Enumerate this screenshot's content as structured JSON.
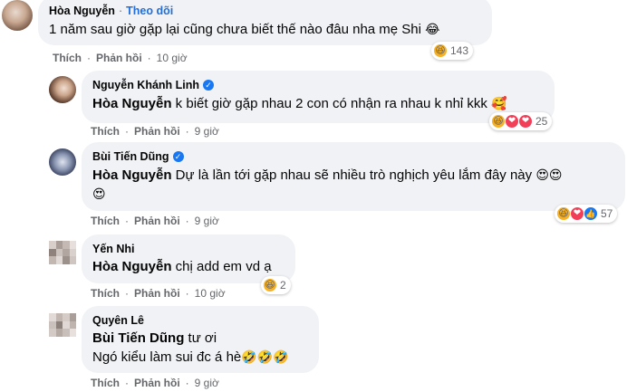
{
  "comments": [
    {
      "author": "Hòa Nguyễn",
      "follow": "Theo dõi",
      "dot": "·",
      "text": "1 năm sau giờ gặp lại cũng chưa biết thế nào đâu nha mẹ Shi",
      "emoji": "😂",
      "like_label": "Thích",
      "reply_label": "Phản hồi",
      "time": "10 giờ",
      "reactions": [
        "haha"
      ],
      "reaction_count": "143"
    },
    {
      "author": "Nguyễn Khánh Linh",
      "verified": true,
      "tag": "Hòa Nguyễn",
      "text": " k biết giờ gặp nhau 2 con có nhận ra nhau k nhỉ kkk",
      "emoji": "🥰",
      "like_label": "Thích",
      "reply_label": "Phản hồi",
      "time": "9 giờ",
      "reactions": [
        "haha",
        "love",
        "love"
      ],
      "reaction_count": "25"
    },
    {
      "author": "Bùi Tiến Dũng",
      "verified": true,
      "tag": "Hòa Nguyễn",
      "text": " Dự là lần tới gặp nhau sẽ nhiều trò nghịch yêu lắm đây này",
      "emoji": "😍😍",
      "emoji_line2": "😍",
      "like_label": "Thích",
      "reply_label": "Phản hồi",
      "time": "9 giờ",
      "reactions": [
        "haha",
        "love",
        "like"
      ],
      "reaction_count": "57"
    },
    {
      "author": "Yến Nhi",
      "tag": "Hòa Nguyễn",
      "text": " chị add em vd ạ",
      "like_label": "Thích",
      "reply_label": "Phản hồi",
      "time": "10 giờ",
      "reactions": [
        "haha"
      ],
      "reaction_count": "2"
    },
    {
      "author": "Quyên Lê",
      "tag": "Bùi Tiến Dũng",
      "text": " tư ơi",
      "text_line2": "Ngó kiểu làm sui đc á hè",
      "emoji": "🤣🤣🤣",
      "like_label": "Thích",
      "reply_label": "Phản hồi",
      "time": "9 giờ"
    }
  ],
  "icons": {
    "verified": "✓",
    "haha": "😆",
    "love": "❤",
    "like": "👍"
  },
  "colors": {
    "bubble": "#f0f2f5",
    "link": "#216fdb",
    "verified": "#1877f2",
    "love": "#f33e58",
    "haha": "#f7b125"
  }
}
